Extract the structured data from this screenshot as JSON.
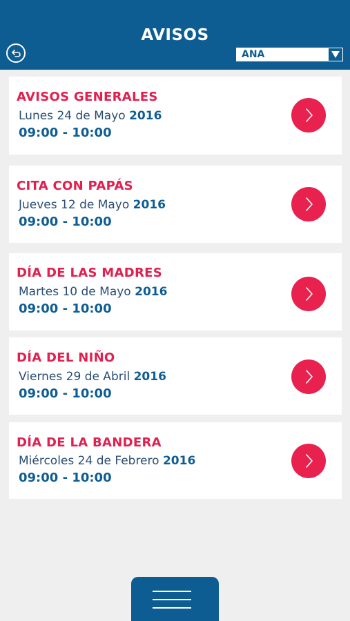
{
  "header": {
    "title": "AVISOS",
    "selector_value": "ANA"
  },
  "notices": [
    {
      "title": "AVISOS GENERALES",
      "date": "Lunes 24 de Mayo",
      "year": "2016",
      "time": "09:00 - 10:00"
    },
    {
      "title": "CITA CON PAPÁS",
      "date": "Jueves 12 de Mayo",
      "year": "2016",
      "time": "09:00 - 10:00"
    },
    {
      "title": "DÍA DE LAS MADRES",
      "date": "Martes 10 de Mayo",
      "year": "2016",
      "time": "09:00 - 10:00"
    },
    {
      "title": "DÍA DEL NIÑO",
      "date": "Viernes 29 de Abril",
      "year": "2016",
      "time": "09:00 - 10:00"
    },
    {
      "title": "DÍA DE LA BANDERA",
      "date": "Miércoles 24 de Febrero",
      "year": "2016",
      "time": "09:00 - 10:00"
    }
  ],
  "icons": {
    "back": "back-arrow-icon",
    "dropdown": "triangle-down-icon",
    "open": "chevron-right-icon",
    "menu": "hamburger-icon"
  },
  "colors": {
    "primary": "#0e5d92",
    "accent": "#e8214f",
    "background": "#efefef"
  }
}
